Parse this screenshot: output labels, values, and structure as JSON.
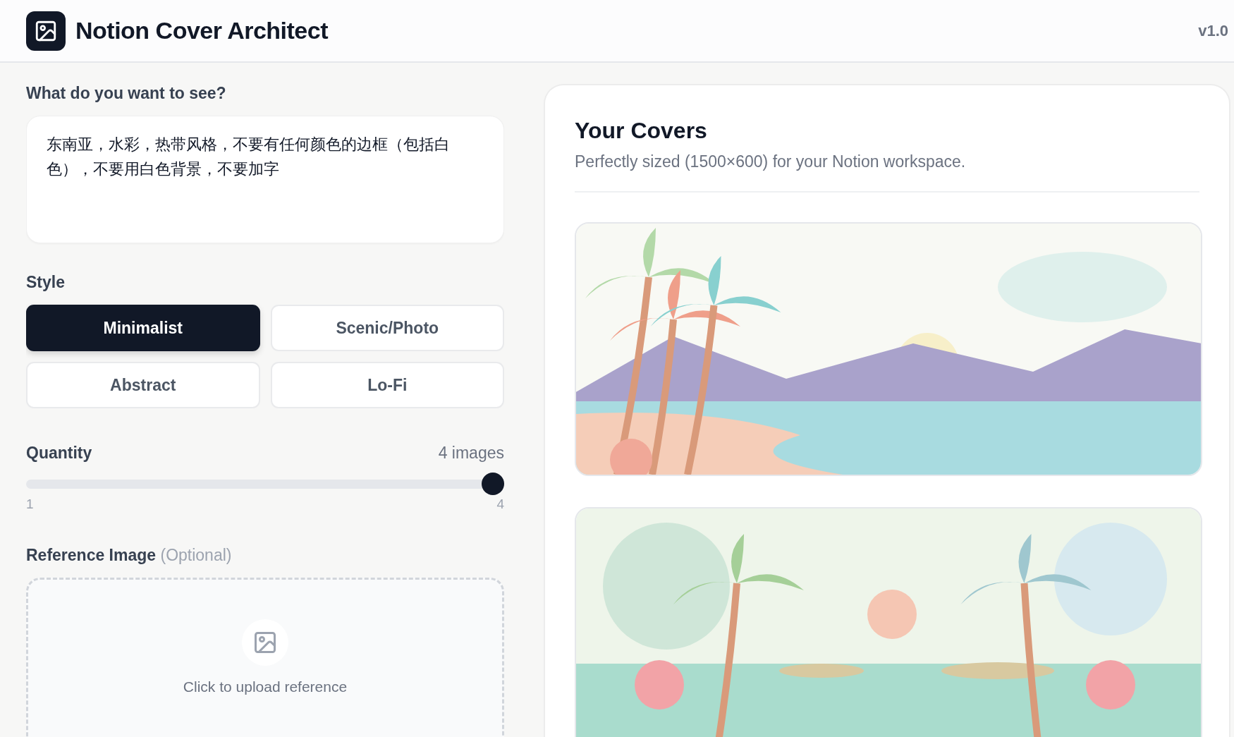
{
  "header": {
    "title": "Notion Cover Architect",
    "version": "v1.0"
  },
  "prompt": {
    "label": "What do you want to see?",
    "value": "东南亚，水彩，热带风格，不要有任何颜色的边框（包括白色），不要用白色背景，不要加字"
  },
  "style": {
    "label": "Style",
    "options": [
      {
        "label": "Minimalist",
        "selected": true
      },
      {
        "label": "Scenic/Photo",
        "selected": false
      },
      {
        "label": "Abstract",
        "selected": false
      },
      {
        "label": "Lo-Fi",
        "selected": false
      }
    ]
  },
  "quantity": {
    "label": "Quantity",
    "reading": "4 images",
    "level": 1,
    "min_label": "1",
    "max_label": "4"
  },
  "reference": {
    "label": "Reference Image",
    "hint": "(Optional)",
    "upload_text": "Click to upload reference"
  },
  "covers": {
    "title": "Your Covers",
    "subtitle": "Perfectly sized (1500×600) for your Notion workspace."
  }
}
